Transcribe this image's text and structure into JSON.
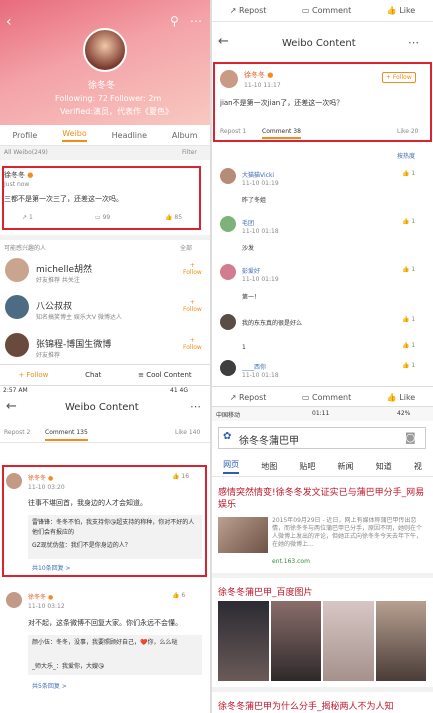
{
  "profile": {
    "name": "徐冬冬",
    "following": "Following: 72",
    "follower": "Follower: 2m",
    "verified": "Verified:演员，代表作《夏色》",
    "tabs": [
      "Profile",
      "Weibo",
      "Headline",
      "Album"
    ],
    "all_weibo": "All Weibo(249)",
    "filter": "Filter",
    "post": {
      "author": "徐冬冬",
      "time": "Just now",
      "text": "三都不是第一次三了，还差这一次吗。",
      "counts": [
        "1",
        "99",
        "85"
      ]
    },
    "suggest_title": "可能感兴趣的人",
    "suggest_all": "全部",
    "people": [
      {
        "name": "michelle胡然",
        "desc": "好友推荐 共关注",
        "follow": "Follow"
      },
      {
        "name": "八公叔叔",
        "desc": "知名搞笑博主 娱乐大V 微博达人",
        "follow": "Follow"
      },
      {
        "name": "张锦程-博国生微博",
        "desc": "好友推荐",
        "follow": "Follow"
      }
    ],
    "bottom": {
      "follow": "Follow",
      "chat": "Chat",
      "cool": "Cool Content"
    }
  },
  "top_right": {
    "actions": [
      "Repost",
      "Comment",
      "Like"
    ],
    "title": "Weibo Content",
    "author": "徐冬冬",
    "time": "11-10 11:17",
    "follow": "+ Follow",
    "text": "jian不是第一次jian了，还差这一次吗？",
    "repost": "Repost 1",
    "comment": "Comment 38",
    "like": "Like 20",
    "sort": "按热度",
    "comments": [
      {
        "user": "大猫猫Vicki",
        "time": "11-10 01:19",
        "text": "昨了冬姐",
        "likes": "1"
      },
      {
        "user": "毛团",
        "time": "11-10 01:18",
        "text": "沙发",
        "likes": "1"
      },
      {
        "user": "彭爱好",
        "time": "11-10 01:19",
        "text": "第一！",
        "likes": "1"
      },
      {
        "user": "",
        "time": "",
        "text": "我的东东真的很是好么",
        "likes": "1"
      },
      {
        "user": "",
        "time": "",
        "text": "1",
        "likes": "1"
      },
      {
        "user": "____西你",
        "time": "11-10 01:18",
        "text": "",
        "likes": "1"
      }
    ],
    "bottom": [
      "Repost",
      "Comment",
      "Like"
    ]
  },
  "bottom_left": {
    "status_time": "2:57 AM",
    "status_right": "41 4G",
    "title": "Weibo Content",
    "repost": "Repost 2",
    "comment": "Comment 135",
    "like": "Like 140",
    "comments": [
      {
        "user": "徐冬冬",
        "time": "11-10 03:20",
        "likes": "16",
        "text": "往事不堪回首，我身边的人才会知道。",
        "replies": [
          "雷锋锋：冬冬不怕，我支持你😘超支持的称种，你对不好的人他们会有报应的",
          "GZ现忧伪蓝：我们不是你身边的人？"
        ],
        "more": "共10条回复 >"
      },
      {
        "user": "徐冬冬",
        "time": "11-10 03:12",
        "likes": "6",
        "text": "对不起，这条微博不回复大家。你们永远不会懂。",
        "replies": [
          "颜小伍：冬冬，没事，我要照顾好自己，❤️你，么么哒",
          "_师大乐_：我爱你，大嫂😘"
        ],
        "more": "共5条回复 >"
      }
    ]
  },
  "bottom_right": {
    "carrier": "中国移动",
    "time": "01:11",
    "battery": "42%",
    "search_text": "徐冬冬蒲巴甲",
    "tabs": [
      "网页",
      "地图",
      "贴吧",
      "新闻",
      "知道",
      "视"
    ],
    "result1_title": "感情突然情变!徐冬冬发文证实已与蒲巴甲分手_网易娱乐",
    "result1_snippet": "2015年09月29日 - 近日，网上有媒体称蒲巴甲传出恋情，而徐冬冬与两位蒲巴甲已分手，原因不明，她则在个人微博上发出的评论，但她正式向徐冬冬今天去年下午，在她的微博上...",
    "result1_url": "ent.163.com",
    "result2_title": "徐冬冬蒲巴甲_百度图片",
    "result3_title": "徐冬冬蒲巴甲为什么分手_揭秘两人不为人知"
  }
}
